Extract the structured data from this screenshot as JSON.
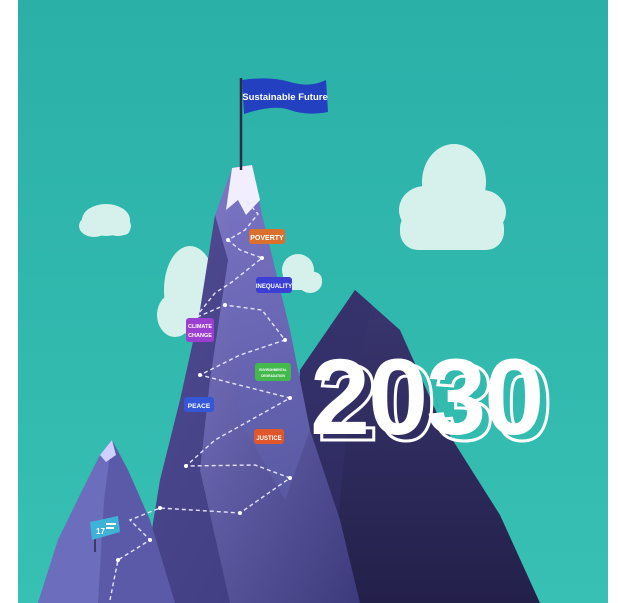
{
  "flag": {
    "text": "Sustainable Future",
    "color": "#1f3fb8"
  },
  "year": "2030",
  "badge": {
    "text": "17"
  },
  "milestones": [
    {
      "id": "poverty",
      "text": "POVERTY",
      "color": "#d9702e"
    },
    {
      "id": "inequality",
      "text": "INEQUALITY",
      "color": "#3b3fd4"
    },
    {
      "id": "climate",
      "lines": [
        "CLIMATE",
        "CHANGE"
      ],
      "color": "#9b3fd0"
    },
    {
      "id": "environmental",
      "lines": [
        "ENVIRONMENTAL",
        "DEGRADATION"
      ],
      "color": "#43b94b"
    },
    {
      "id": "peace",
      "text": "PEACE",
      "color": "#3357d6"
    },
    {
      "id": "justice",
      "text": "JUSTICE",
      "color": "#e0572c"
    }
  ],
  "colors": {
    "sky": "#2eb3aa",
    "cloud": "#d9f2ef",
    "mountain_main": "#4b4a8f",
    "mountain_light": "#6f6bb3",
    "mountain_back": "#2f2c5c",
    "snow": "#f3f0ff"
  }
}
